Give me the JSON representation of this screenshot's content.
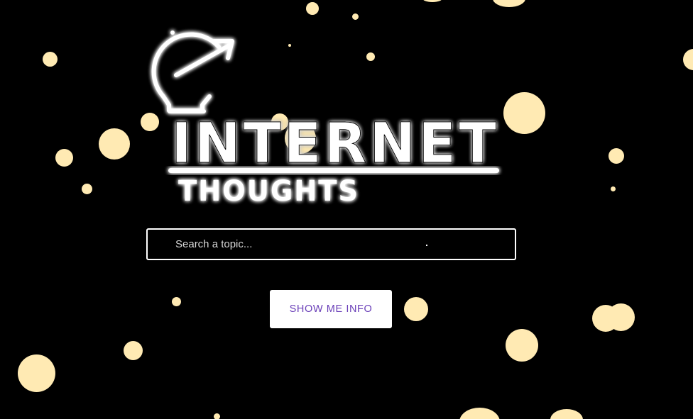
{
  "logo": {
    "title_line1": "INTERNET",
    "title_line2": "THOUGHTS",
    "icon": "lightbulb-arrow-icon"
  },
  "search": {
    "placeholder": "Search a topic...",
    "value": ""
  },
  "actions": {
    "show_info_label": "SHOW ME INFO"
  },
  "colors": {
    "background": "#000000",
    "bubble": "#FFEAB3",
    "button_text": "#6A3FB8",
    "glow": "#ffffff"
  }
}
